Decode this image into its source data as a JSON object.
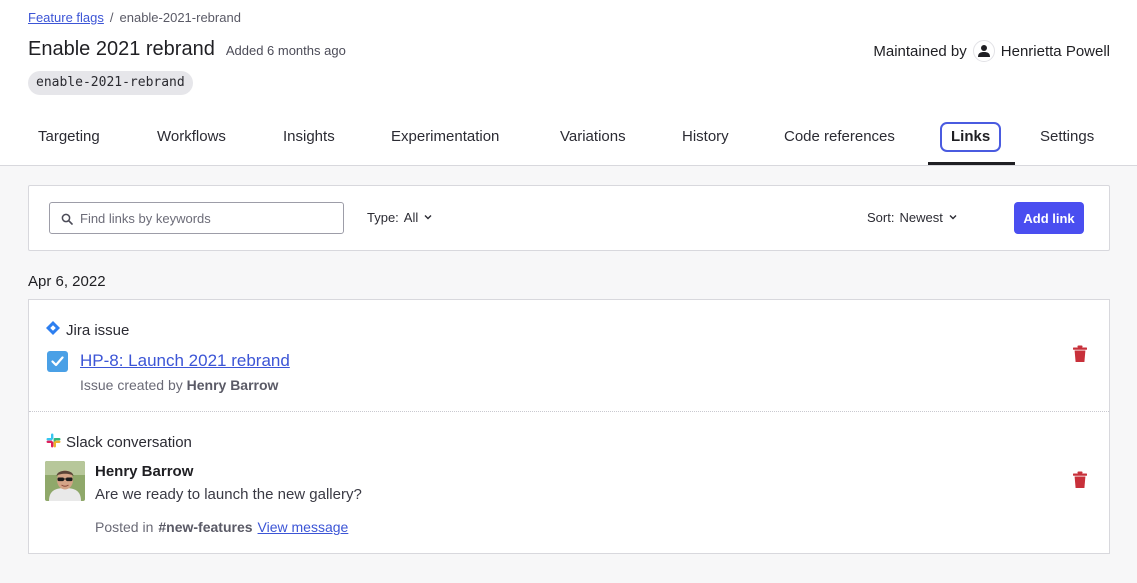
{
  "breadcrumb": {
    "parent": "Feature flags",
    "separator": "/",
    "current": "enable-2021-rebrand"
  },
  "flag": {
    "name": "Enable 2021 rebrand",
    "added": "Added 6 months ago",
    "key": "enable-2021-rebrand"
  },
  "maintainer": {
    "label": "Maintained by",
    "name": "Henrietta Powell"
  },
  "tabs": [
    {
      "label": "Targeting"
    },
    {
      "label": "Workflows"
    },
    {
      "label": "Insights"
    },
    {
      "label": "Experimentation"
    },
    {
      "label": "Variations"
    },
    {
      "label": "History"
    },
    {
      "label": "Code references"
    },
    {
      "label": "Links",
      "active": true
    },
    {
      "label": "Settings"
    }
  ],
  "filters": {
    "search_placeholder": "Find links by keywords",
    "type_label": "Type:",
    "type_value": "All",
    "sort_label": "Sort:",
    "sort_value": "Newest",
    "add_link": "Add link"
  },
  "date_group": "Apr 6, 2022",
  "links": {
    "jira": {
      "kind": "Jira issue",
      "title": "HP-8: Launch 2021 rebrand",
      "meta_prefix": "Issue created by",
      "meta_author": "Henry Barrow"
    },
    "slack": {
      "kind": "Slack conversation",
      "author": "Henry Barrow",
      "message": "Are we ready to launch the new gallery?",
      "posted_prefix": "Posted in",
      "channel": "#new-features",
      "view": "View message"
    }
  },
  "colors": {
    "accent": "#4a4ef0",
    "link": "#3c55d6",
    "delete": "#c8303a",
    "jira": "#2d7ff0",
    "checkbox": "#4aa0e6"
  }
}
